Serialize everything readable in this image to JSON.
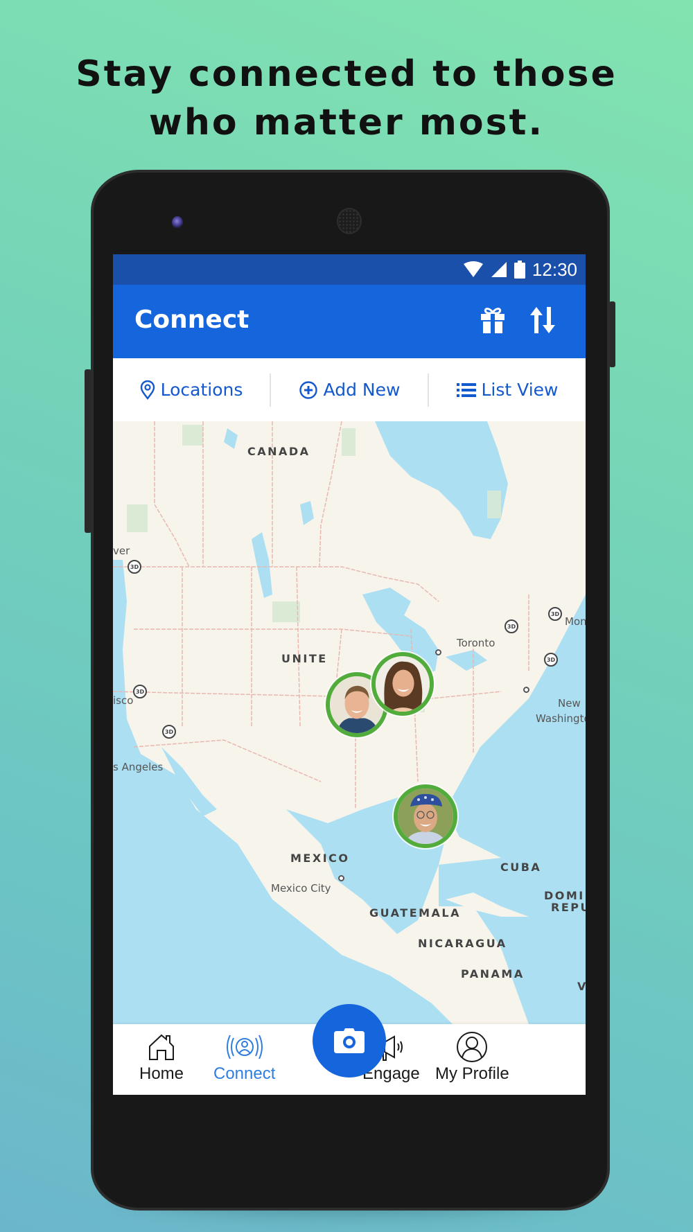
{
  "headline": {
    "line1": "Stay connected to those",
    "line2": "who matter most."
  },
  "status_bar": {
    "time": "12:30",
    "icons": [
      "wifi-icon",
      "cell-signal-icon",
      "battery-icon"
    ]
  },
  "app_bar": {
    "title": "Connect",
    "actions": [
      {
        "icon": "gift-icon",
        "label": "Gift"
      },
      {
        "icon": "sort-icon",
        "label": "Sort"
      }
    ],
    "color": "#1565dc"
  },
  "tabs": [
    {
      "icon": "location-pin-icon",
      "label": "Locations"
    },
    {
      "icon": "add-circle-icon",
      "label": "Add New"
    },
    {
      "icon": "list-icon",
      "label": "List View"
    }
  ],
  "map": {
    "country_labels": [
      "CANADA",
      "UNITE",
      "MEXICO",
      "CUBA",
      "DOMIN",
      "REPU",
      "GUATEMALA",
      "NICARAGUA",
      "PANAMA",
      "V"
    ],
    "city_labels": [
      "ver",
      "Toronto",
      "Mon",
      "New",
      "Washingto",
      "isco",
      "s Angeles",
      "Mexico City"
    ],
    "badge_3d": "3D",
    "people": [
      {
        "name": "man-avatar",
        "status_color": "#52ac3c"
      },
      {
        "name": "woman-avatar",
        "status_color": "#52ac3c"
      },
      {
        "name": "elderly-man-avatar",
        "status_color": "#52ac3c"
      }
    ]
  },
  "bottom_nav": {
    "items": [
      {
        "icon": "home-icon",
        "label": "Home",
        "active": false
      },
      {
        "icon": "connect-icon",
        "label": "Connect",
        "active": true
      },
      {
        "icon": "megaphone-icon",
        "label": "Engage",
        "active": false
      },
      {
        "icon": "profile-icon",
        "label": "My Profile",
        "active": false
      }
    ],
    "fab_icon": "camera-icon",
    "active_color": "#2f7de0"
  }
}
